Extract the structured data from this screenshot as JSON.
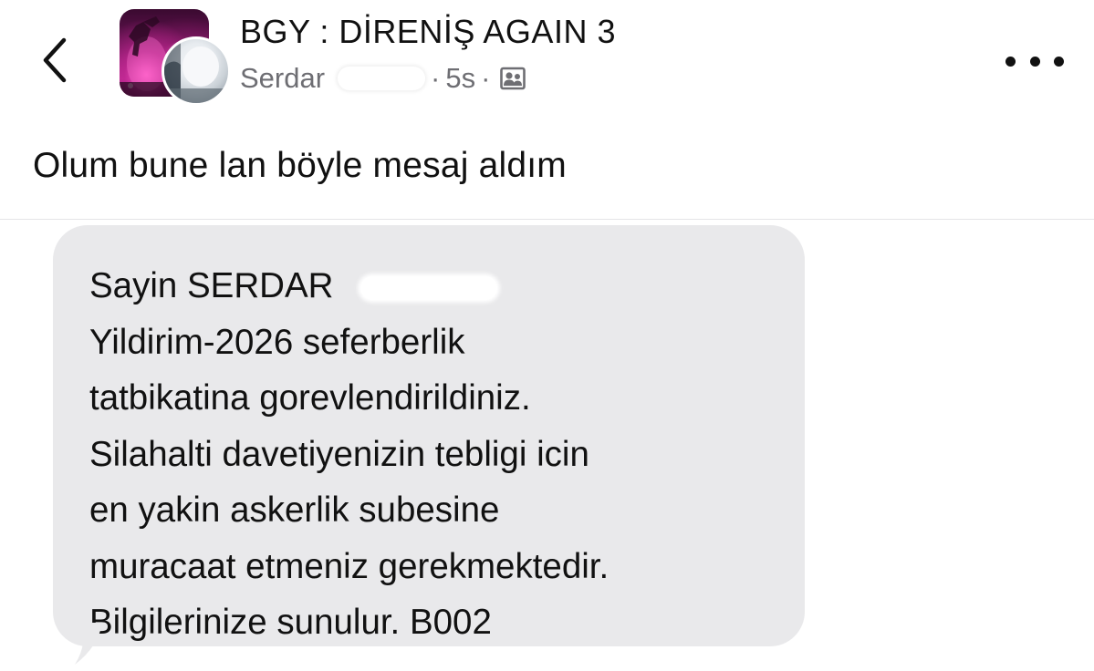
{
  "header": {
    "back_icon": "chevron-left-icon",
    "group_title": "BGY : DİRENİŞ AGAIN 3",
    "author_name": "Serdar",
    "separator": "·",
    "time_ago": "5s",
    "privacy_icon": "group-members-icon",
    "more_icon": "ellipsis-icon"
  },
  "post": {
    "text": "Olum bune lan böyle mesaj aldım"
  },
  "sms": {
    "greeting": "Sayin SERDAR",
    "lines": [
      "Yildirim-2026 seferberlik",
      "tatbikatina gorevlendirildiniz.",
      "Silahalti davetiyenizin tebligi icin",
      "en yakin askerlik subesine",
      "muracaat etmeniz gerekmektedir.",
      "Bilgilerinize sunulur. B002"
    ],
    "bubble_color": "#e9e9eb"
  }
}
